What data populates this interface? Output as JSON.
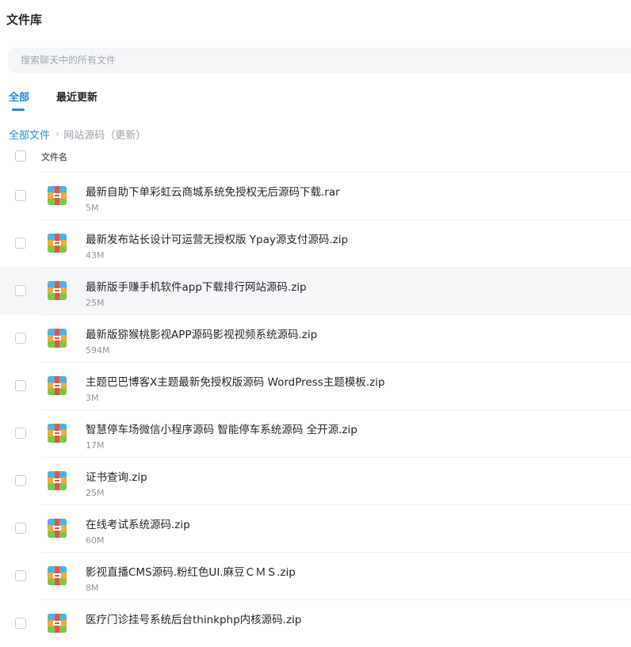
{
  "header": {
    "title": "文件库"
  },
  "search": {
    "placeholder": "搜索聊天中的所有文件",
    "value": ""
  },
  "tabs": [
    {
      "label": "全部",
      "active": true
    },
    {
      "label": "最近更新",
      "active": false
    }
  ],
  "breadcrumb": {
    "root": "全部文件",
    "separator": "›",
    "current": "网站源码（更新）"
  },
  "list": {
    "column_name": "文件名",
    "files": [
      {
        "name": "最新自助下单彩虹云商城系统免授权无后源码下载.rar",
        "size": "5M"
      },
      {
        "name": "最新发布站长设计可运营无授权版 Ypay源支付源码.zip",
        "size": "43M"
      },
      {
        "name": "最新版手赚手机软件app下载排行网站源码.zip",
        "size": "25M"
      },
      {
        "name": "最新版猕猴桃影视APP源码影视视频系统源码.zip",
        "size": "594M"
      },
      {
        "name": "主题巴巴博客X主题最新免授权版源码 WordPress主题模板.zip",
        "size": "3M"
      },
      {
        "name": "智慧停车场微信小程序源码 智能停车系统源码 全开源.zip",
        "size": "17M"
      },
      {
        "name": "证书查询.zip",
        "size": "25M"
      },
      {
        "name": "在线考试系统源码.zip",
        "size": "60M"
      },
      {
        "name": "影视直播CMS源码.粉红色UI.麻豆ＣＭＳ.zip",
        "size": "8M"
      },
      {
        "name": "医疗门诊挂号系统后台thinkphp内核源码.zip",
        "size": ""
      }
    ]
  },
  "colors": {
    "accent": "#1f8ce0",
    "hover_row": "#f5f6f8"
  },
  "icons": {
    "file": "archive-icon"
  }
}
